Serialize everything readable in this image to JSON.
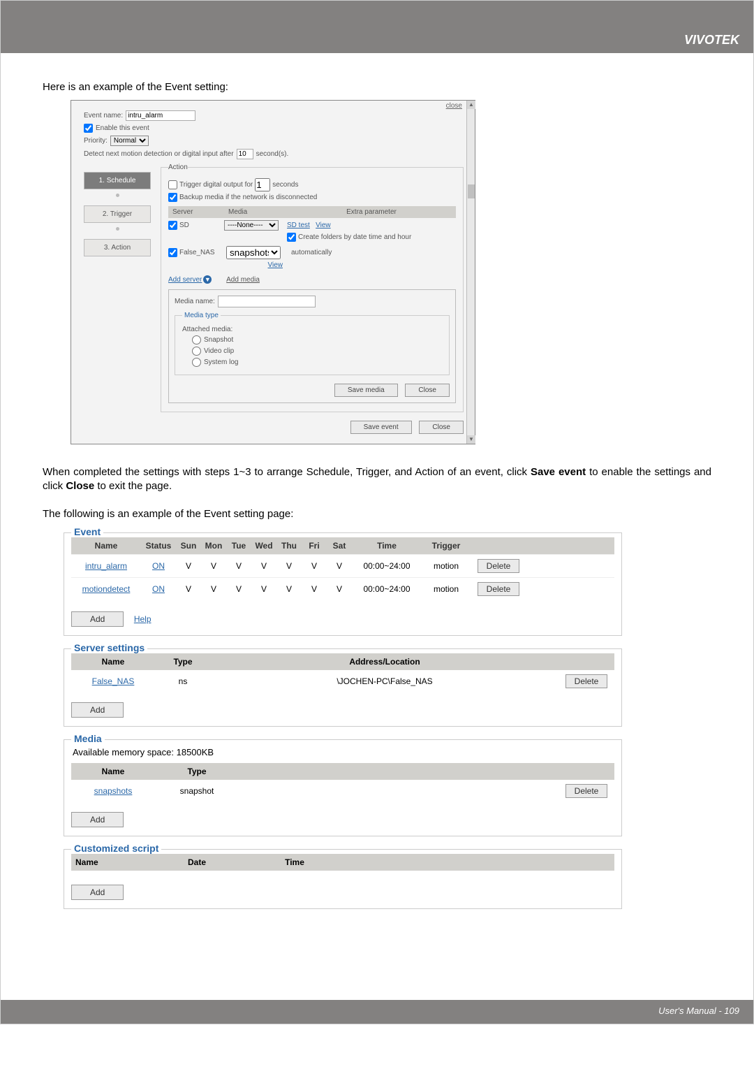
{
  "header": {
    "brand": "VIVOTEK"
  },
  "intro1": "Here is an example of the Event setting:",
  "ss": {
    "close": "close",
    "eventName": {
      "label": "Event name:",
      "value": "intru_alarm"
    },
    "enable": "Enable this event",
    "priority": {
      "label": "Priority:",
      "selected": "Normal"
    },
    "detectLine": {
      "pre": "Detect next motion detection or digital input after",
      "value": "10",
      "post": "second(s)."
    },
    "steps": {
      "s1": "1. Schedule",
      "s2": "2. Trigger",
      "s3": "3. Action"
    },
    "actionLegend": "Action",
    "triggerDigital": {
      "label": "Trigger digital output for",
      "value": "1",
      "post": "seconds"
    },
    "backup": "Backup media if the network is disconnected",
    "hdr": {
      "server": "Server",
      "media": "Media",
      "extra": "Extra parameter"
    },
    "sd": {
      "label": "SD",
      "noneOpt": "----None----",
      "sdtest": "SD test",
      "view": "View"
    },
    "createFolders": "Create folders by date time and hour",
    "falseNas": {
      "label": "False_NAS",
      "mediaOpt": "snapshots",
      "auto": "automatically"
    },
    "view2": "View",
    "addServer": "Add server",
    "addMedia": "Add media",
    "mediaName": {
      "label": "Media name:"
    },
    "mediaTypeLegend": "Media type",
    "attached": "Attached media:",
    "radios": {
      "snap": "Snapshot",
      "clip": "Video clip",
      "syslog": "System log"
    },
    "btns": {
      "saveMedia": "Save media",
      "closeMedia": "Close",
      "saveEvent": "Save event",
      "closeEvent": "Close"
    }
  },
  "bodyText": "When completed the settings with steps 1~3 to arrange Schedule, Trigger, and Action of an event, click <b>Save event</b> to enable the settings and click <b>Close</b> to exit the page.",
  "bodyLine1": "When completed the settings with steps 1~3 to arrange Schedule, Trigger, and Action of an event, click ",
  "bodyBold1": "Save event",
  "bodyMid": " to enable the settings and click ",
  "bodyBold2": "Close",
  "bodyEnd": " to exit the page.",
  "intro2": "The following is an example of the Event setting page:",
  "eventPanel": {
    "legend": "Event",
    "headers": {
      "name": "Name",
      "status": "Status",
      "sun": "Sun",
      "mon": "Mon",
      "tue": "Tue",
      "wed": "Wed",
      "thu": "Thu",
      "fri": "Fri",
      "sat": "Sat",
      "time": "Time",
      "trigger": "Trigger"
    },
    "rows": [
      {
        "name": "intru_alarm",
        "status": "ON",
        "days": [
          "V",
          "V",
          "V",
          "V",
          "V",
          "V",
          "V"
        ],
        "time": "00:00~24:00",
        "trigger": "motion"
      },
      {
        "name": "motiondetect",
        "status": "ON",
        "days": [
          "V",
          "V",
          "V",
          "V",
          "V",
          "V",
          "V"
        ],
        "time": "00:00~24:00",
        "trigger": "motion"
      }
    ],
    "add": "Add",
    "help": "Help",
    "delete": "Delete"
  },
  "serverPanel": {
    "legend": "Server settings",
    "headers": {
      "name": "Name",
      "type": "Type",
      "addr": "Address/Location"
    },
    "rows": [
      {
        "name": "False_NAS",
        "type": "ns",
        "addr": "\\JOCHEN-PC\\False_NAS"
      }
    ],
    "add": "Add",
    "delete": "Delete"
  },
  "mediaPanel": {
    "legend": "Media",
    "memLine": "Available memory space: 18500KB",
    "headers": {
      "name": "Name",
      "type": "Type"
    },
    "rows": [
      {
        "name": "snapshots",
        "type": "snapshot"
      }
    ],
    "add": "Add",
    "delete": "Delete"
  },
  "csPanel": {
    "legend": "Customized script",
    "headers": {
      "name": "Name",
      "date": "Date",
      "time": "Time"
    },
    "add": "Add"
  },
  "footer": {
    "text": "User's Manual - 109"
  }
}
